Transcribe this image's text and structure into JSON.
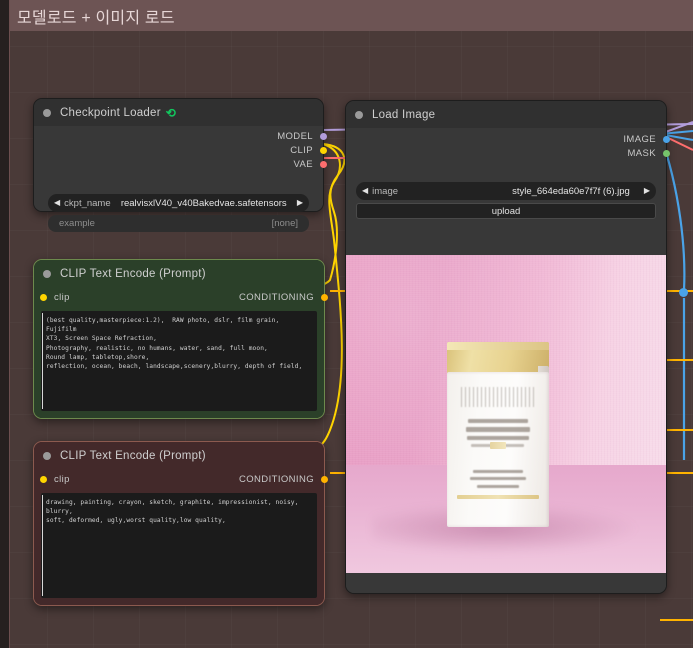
{
  "group": {
    "title": "모델로드 + 이미지 로드",
    "color": "#6d5454",
    "body_color": "#4a3a38"
  },
  "nodes": [
    {
      "id": "checkpoint_loader",
      "title": "Checkpoint Loader",
      "badge_icon": "leaf-icon",
      "outputs": [
        {
          "label": "MODEL",
          "color": "#b39ddb"
        },
        {
          "label": "CLIP",
          "color": "#ffd500"
        },
        {
          "label": "VAE",
          "color": "#ff6e6e"
        }
      ],
      "widgets": [
        {
          "name": "ckpt_name",
          "value": "realvisxlV40_v40Bakedvae.safetensors",
          "left_arrow": "◀",
          "right_arrow": "▶"
        }
      ],
      "flat_widgets": [
        {
          "name": "example",
          "value": "[none]"
        }
      ]
    },
    {
      "id": "load_image",
      "title": "Load Image",
      "outputs": [
        {
          "label": "IMAGE",
          "color": "#4aa3e8"
        },
        {
          "label": "MASK",
          "color": "#76c36b"
        }
      ],
      "widgets": [
        {
          "name": "image",
          "value": "style_664eda60e7f7f (6).jpg",
          "left_arrow": "◀",
          "right_arrow": "▶"
        }
      ],
      "buttons": [
        {
          "label": "upload"
        }
      ],
      "preview": {
        "alt": "cosmetic bottle with gold cap on pink background"
      }
    },
    {
      "id": "clip_text_encode_positive",
      "title": "CLIP Text Encode (Prompt)",
      "accent": "#6d8a4d",
      "inputs": [
        {
          "label": "clip",
          "color": "#ffd500"
        }
      ],
      "outputs": [
        {
          "label": "CONDITIONING",
          "color": "#ffb300"
        }
      ],
      "text": "(best quality,masterpiece:1.2),  RAW photo, dslr, film grain, Fujifilm\nXT3, Screen Space Refraction,\nPhotography, realistic, no humans, water, sand, full moon,\nRound lamp, tabletop,shore,\nreflection, ocean, beach, landscape,scenery,blurry, depth of field,"
    },
    {
      "id": "clip_text_encode_negative",
      "title": "CLIP Text Encode (Prompt)",
      "accent": "#8c5a4f",
      "inputs": [
        {
          "label": "clip",
          "color": "#ffd500"
        }
      ],
      "outputs": [
        {
          "label": "CONDITIONING",
          "color": "#ffb300"
        }
      ],
      "text": "drawing, painting, crayon, sketch, graphite, impressionist, noisy, blurry,\nsoft, deformed, ugly,worst quality,low quality,"
    }
  ],
  "wire_colors": {
    "model": "#b39ddb",
    "clip": "#ffd500",
    "vae": "#ff6e6e",
    "image": "#4aa3e8",
    "mask": "#76c36b",
    "conditioning": "#ffb300"
  }
}
